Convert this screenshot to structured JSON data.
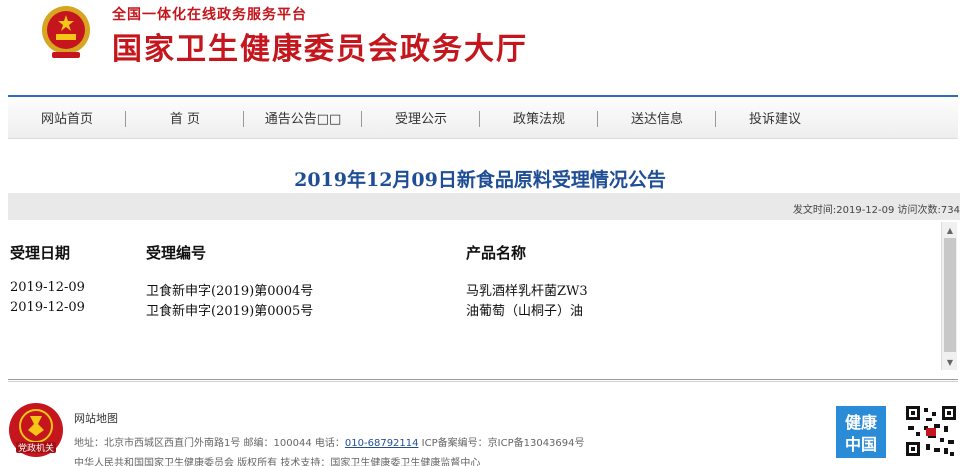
{
  "header": {
    "subtitle": "全国一体化在线政务服务平台",
    "title": "国家卫生健康委员会政务大厅"
  },
  "nav": [
    {
      "label": "网站首页"
    },
    {
      "label": "首  页"
    },
    {
      "label": "通告公告□□"
    },
    {
      "label": "受理公示"
    },
    {
      "label": "政策法规"
    },
    {
      "label": "送达信息"
    },
    {
      "label": "投诉建议"
    }
  ],
  "article": {
    "title": "2019年12月09日新食品原料受理情况公告",
    "meta": "发文时间:2019-12-09  访问次数:734"
  },
  "table": {
    "headers": [
      "受理日期",
      "受理编号",
      "产品名称"
    ],
    "rows": [
      [
        "2019-12-09",
        "卫食新申字(2019)第0004号",
        "马乳酒样乳杆菌ZW3"
      ],
      [
        "2019-12-09",
        "卫食新申字(2019)第0005号",
        "油葡萄（山桐子）油"
      ]
    ]
  },
  "footer": {
    "sitemap": "网站地图",
    "addr_label": "地址：北京市西城区西直门外南路1号    邮编：100044    电话：",
    "phone": "010-68792114",
    "icp": "    ICP备案编号：京ICP备13043694号",
    "copyright": "中华人民共和国国家卫生健康委员会 版权所有    技术支持：国家卫生健康委卫生健康监督中心",
    "logo_text": "党政机关",
    "health_text": [
      "健康",
      "中国"
    ]
  },
  "colors": {
    "brand_red": "#c4161c",
    "nav_blue": "#2d6db5",
    "title_blue": "#1f4e96"
  }
}
